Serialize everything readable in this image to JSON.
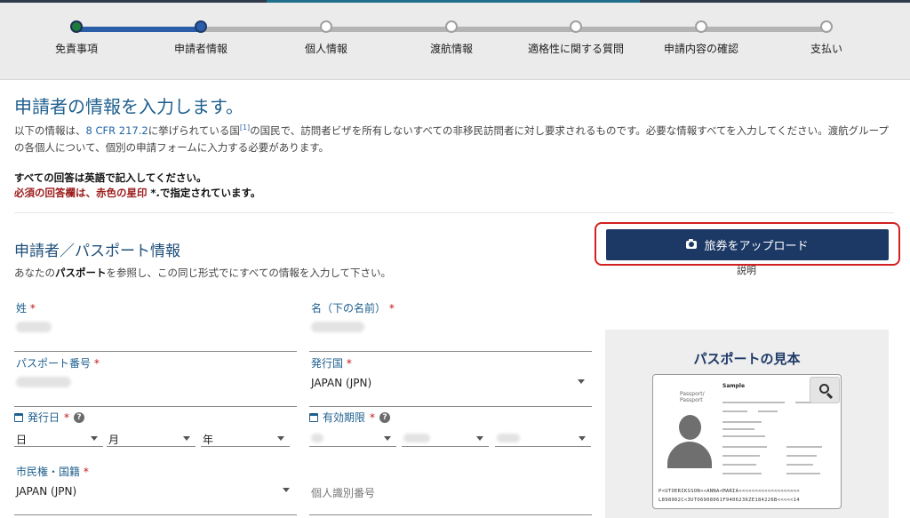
{
  "progress": {
    "steps": [
      {
        "label": "免責事項",
        "state": "done"
      },
      {
        "label": "申請者情報",
        "state": "current"
      },
      {
        "label": "個人情報",
        "state": "todo"
      },
      {
        "label": "渡航情報",
        "state": "todo"
      },
      {
        "label": "適格性に関する質問",
        "state": "todo"
      },
      {
        "label": "申請内容の確認",
        "state": "todo"
      },
      {
        "label": "支払い",
        "state": "todo"
      }
    ]
  },
  "page": {
    "title": "申請者の情報を入力します。",
    "intro_prefix": "以下の情報は、",
    "intro_link": "8 CFR 217.2",
    "intro_mid": "に挙げられている国",
    "intro_footnote": "[1]",
    "intro_suffix": "の国民で、訪問者ビザを所有しないすべての非移民訪問者に対し要求されるものです。必要な情報すべてを入力してください。渡航グループの各個人について、個別の申請フォームに入力する必要があります。",
    "note_english": "すべての回答は英語で記入してください。",
    "note_required": "必須の回答欄は、赤色の星印",
    "note_required_tail": " *.で指定されています。"
  },
  "section": {
    "title": "申請者／パスポート情報",
    "subtitle_prefix": "あなたの",
    "subtitle_bold": "パスポート",
    "subtitle_suffix": "を参照し、この同じ形式でにすべての情報を入力して下さい。"
  },
  "upload": {
    "button_label": "旅券をアップロード",
    "explain_link": "説明"
  },
  "form": {
    "surname_label": "姓",
    "given_name_label": "名（下の名前）",
    "passport_number_label": "パスポート番号",
    "issuing_country_label": "発行国",
    "issuing_country_value": "JAPAN (JPN)",
    "issue_date_label": "発行日",
    "issue_day_ph": "日",
    "issue_month_ph": "月",
    "issue_year_ph": "年",
    "expiry_date_label": "有効期限",
    "citizenship_label": "市民権・国籍",
    "citizenship_value": "JAPAN (JPN)",
    "personal_id_placeholder": "個人識別番号",
    "required_mark": "*",
    "help_mark": "?"
  },
  "sample": {
    "title": "パスポートの見本",
    "card_label": "Sample",
    "card_type": "Passport/\nPassport",
    "mrz_line1": "P<UTOERIKSSON<<ANNA<MARIA<<<<<<<<<<<<<<<<<<<",
    "mrz_line2": "L898902C<3UTO6908061F9406236ZE184226B<<<<<14"
  },
  "colors": {
    "accent_blue": "#1c3966",
    "heading_blue": "#1e5f8e",
    "required_red": "#c01818",
    "highlight_red": "#d32020",
    "step_done_green": "#1b7a3c"
  }
}
